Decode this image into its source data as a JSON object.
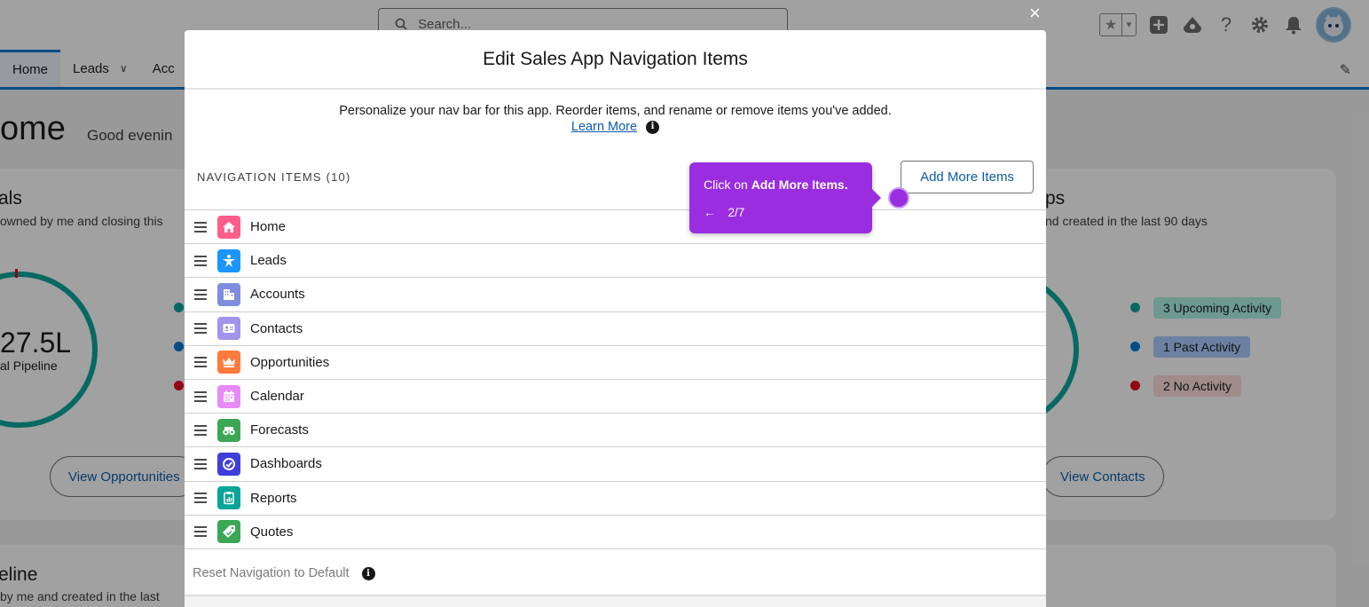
{
  "topbar": {
    "search_placeholder": "Search...",
    "icons": [
      "star-icon",
      "chevron-down-icon",
      "add-icon",
      "trailhead-icon",
      "help-icon",
      "gear-icon",
      "bell-icon",
      "avatar"
    ]
  },
  "navbar": {
    "tabs": [
      {
        "label": "Home",
        "active": true
      },
      {
        "label": "Leads",
        "has_menu": true
      },
      {
        "label": "Acc",
        "has_menu": false
      }
    ]
  },
  "page": {
    "title": "ome",
    "greeting": "Good evenin"
  },
  "cards": {
    "left": {
      "title": "als",
      "subtitle": "owned by me and closing this",
      "value": "27.5L",
      "value_label": "al Pipeline",
      "button": "View Opportunities"
    },
    "right": {
      "title": "ps",
      "subtitle": "nd created in the last 90 days",
      "legend": [
        {
          "label": "3 Upcoming Activity",
          "color": "#06a59a",
          "bg": "#acf3e4"
        },
        {
          "label": "1 Past Activity",
          "color": "#0176d3",
          "bg": "#aacbff"
        },
        {
          "label": "2 No Activity",
          "color": "#ea001e",
          "bg": "#feded8"
        }
      ],
      "button": "View Contacts"
    },
    "left_bottom": {
      "title": "eline",
      "subtitle": "by me and created in the last"
    }
  },
  "modal": {
    "close": "×",
    "title": "Edit Sales App Navigation Items",
    "intro": "Personalize your nav bar for this app. Reorder items, and rename or remove items you've added.",
    "learn_more": "Learn More",
    "info_glyph": "i",
    "section_label": "NAVIGATION ITEMS (10)",
    "add_button": "Add More Items",
    "items": [
      {
        "label": "Home",
        "icon": "home-icon",
        "color": "#ff5d8a"
      },
      {
        "label": "Leads",
        "icon": "lead-icon",
        "color": "#1b96ff"
      },
      {
        "label": "Accounts",
        "icon": "account-icon",
        "color": "#7f8de1"
      },
      {
        "label": "Contacts",
        "icon": "contact-icon",
        "color": "#a094ed"
      },
      {
        "label": "Opportunities",
        "icon": "opportunity-icon",
        "color": "#ff7b3d"
      },
      {
        "label": "Calendar",
        "icon": "calendar-icon",
        "color": "#e88af7"
      },
      {
        "label": "Forecasts",
        "icon": "forecast-icon",
        "color": "#3ba755"
      },
      {
        "label": "Dashboards",
        "icon": "dashboard-icon",
        "color": "#3e3edb"
      },
      {
        "label": "Reports",
        "icon": "report-icon",
        "color": "#06a59a"
      },
      {
        "label": "Quotes",
        "icon": "quote-icon",
        "color": "#3ba755"
      }
    ],
    "reset_label": "Reset Navigation to Default"
  },
  "tooltip": {
    "prefix": "Click on ",
    "bold": "Add More Items.",
    "back_arrow": "←",
    "step": "2/7",
    "color": "#9a2de0"
  }
}
